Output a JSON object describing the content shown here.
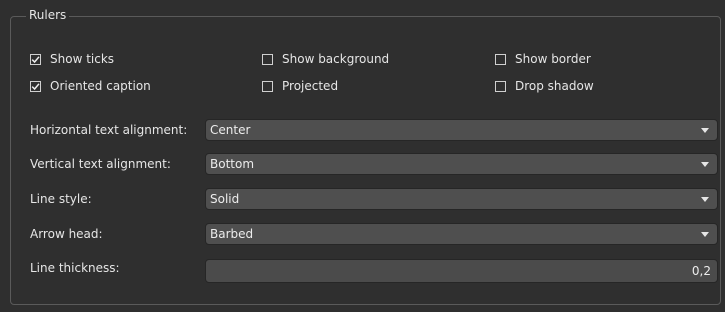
{
  "group": {
    "title": "Rulers"
  },
  "checkboxes": {
    "show_ticks": {
      "label": "Show ticks",
      "checked": true
    },
    "show_background": {
      "label": "Show background",
      "checked": false
    },
    "show_border": {
      "label": "Show border",
      "checked": false
    },
    "oriented_caption": {
      "label": "Oriented caption",
      "checked": true
    },
    "projected": {
      "label": "Projected",
      "checked": false
    },
    "drop_shadow": {
      "label": "Drop shadow",
      "checked": false
    }
  },
  "fields": {
    "horizontal_alignment": {
      "label": "Horizontal text alignment:",
      "value": "Center"
    },
    "vertical_alignment": {
      "label": "Vertical text alignment:",
      "value": "Bottom"
    },
    "line_style": {
      "label": "Line style:",
      "value": "Solid"
    },
    "arrow_head": {
      "label": "Arrow head:",
      "value": "Barbed"
    },
    "line_thickness": {
      "label": "Line thickness:",
      "value": "0,2"
    }
  },
  "colors": {
    "background": "#2f2f2f",
    "control": "#4f4f4f",
    "border": "#5a5a5a",
    "text": "#e6e6e6"
  }
}
